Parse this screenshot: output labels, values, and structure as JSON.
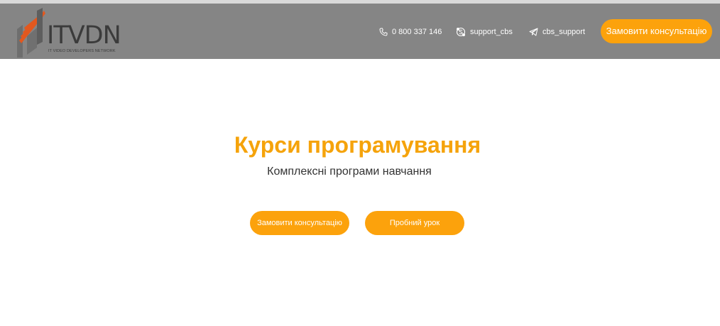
{
  "header": {
    "logo": {
      "name": "ITVDN",
      "tagline": "IT VIDEO DEVELOPERS NETWORK"
    },
    "contacts": [
      {
        "icon": "phone-icon",
        "text": "0 800 337 146"
      },
      {
        "icon": "skype-icon",
        "text": "support_cbs"
      },
      {
        "icon": "telegram-icon",
        "text": "cbs_support"
      }
    ],
    "cta_label": "Замовити консультацію"
  },
  "hero": {
    "title": "Курси програмування",
    "subtitle": "Комплексні програми навчання",
    "buttons": {
      "consultation": "Замовити консультацію",
      "trial": "Пробний урок"
    }
  },
  "colors": {
    "accent": "#fca20c",
    "title": "#f5a30b",
    "header_bg": "#858585"
  }
}
